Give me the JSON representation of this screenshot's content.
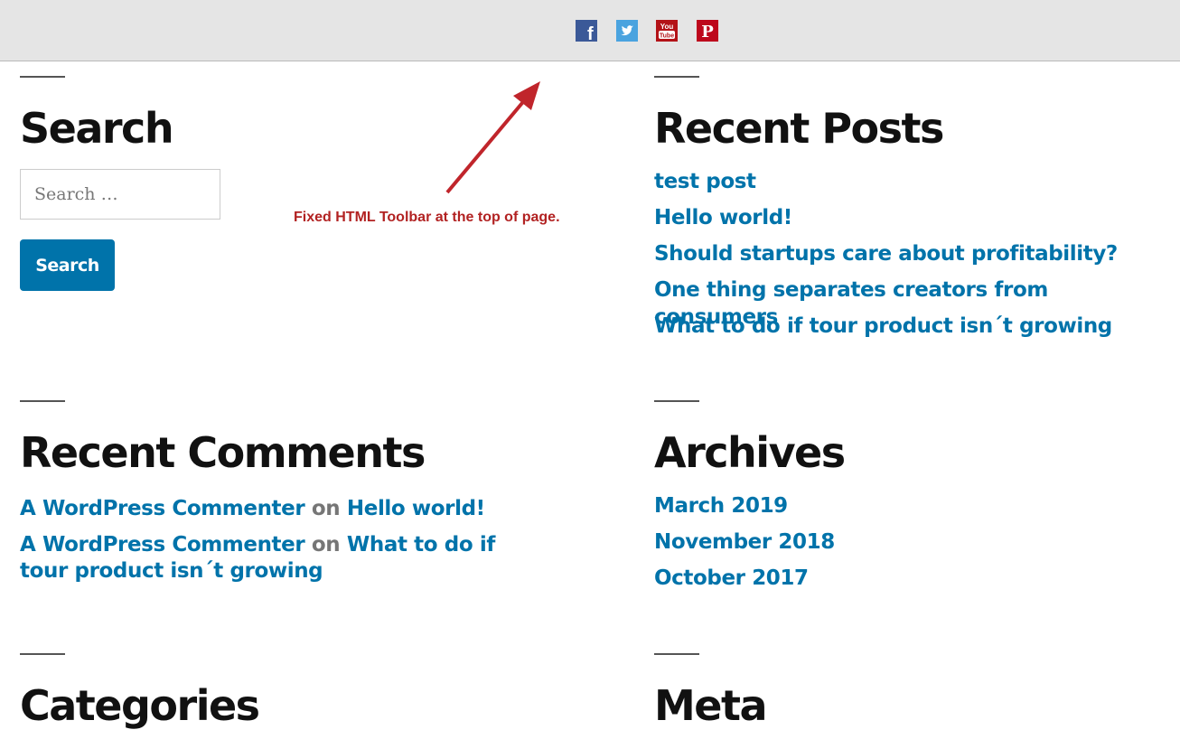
{
  "toolbar": {
    "social": [
      {
        "name": "facebook",
        "icon": "facebook-icon",
        "glyph": "f",
        "color": "#3b5998"
      },
      {
        "name": "twitter",
        "icon": "twitter-icon",
        "color": "#4aa3df"
      },
      {
        "name": "youtube",
        "icon": "youtube-icon",
        "glyph_top": "You",
        "glyph_bottom": "Tube",
        "color": "#b31217"
      },
      {
        "name": "pinterest",
        "icon": "pinterest-icon",
        "glyph": "P",
        "color": "#bd081c"
      }
    ]
  },
  "annotation": {
    "text": "Fixed HTML Toolbar at the top of page.",
    "color": "#b22222"
  },
  "search": {
    "title": "Search",
    "placeholder": "Search …",
    "button_label": "Search"
  },
  "recent_posts": {
    "title": "Recent Posts",
    "items": [
      "test post",
      "Hello world!",
      "Should startups care about profitability?",
      "One thing separates creators from consumers",
      "What to do if tour product isn´t growing"
    ]
  },
  "recent_comments": {
    "title": "Recent Comments",
    "items": [
      {
        "author": "A WordPress Commenter",
        "sep": "on",
        "post": "Hello world!"
      },
      {
        "author": "A WordPress Commenter",
        "sep": "on",
        "post": "What to do if tour product isn´t growing"
      }
    ]
  },
  "archives": {
    "title": "Archives",
    "items": [
      "March 2019",
      "November 2018",
      "October 2017"
    ]
  },
  "categories": {
    "title": "Categories"
  },
  "meta": {
    "title": "Meta"
  },
  "colors": {
    "link": "#0073aa",
    "toolbar_bg": "#e5e5e5",
    "heading": "#111111"
  }
}
